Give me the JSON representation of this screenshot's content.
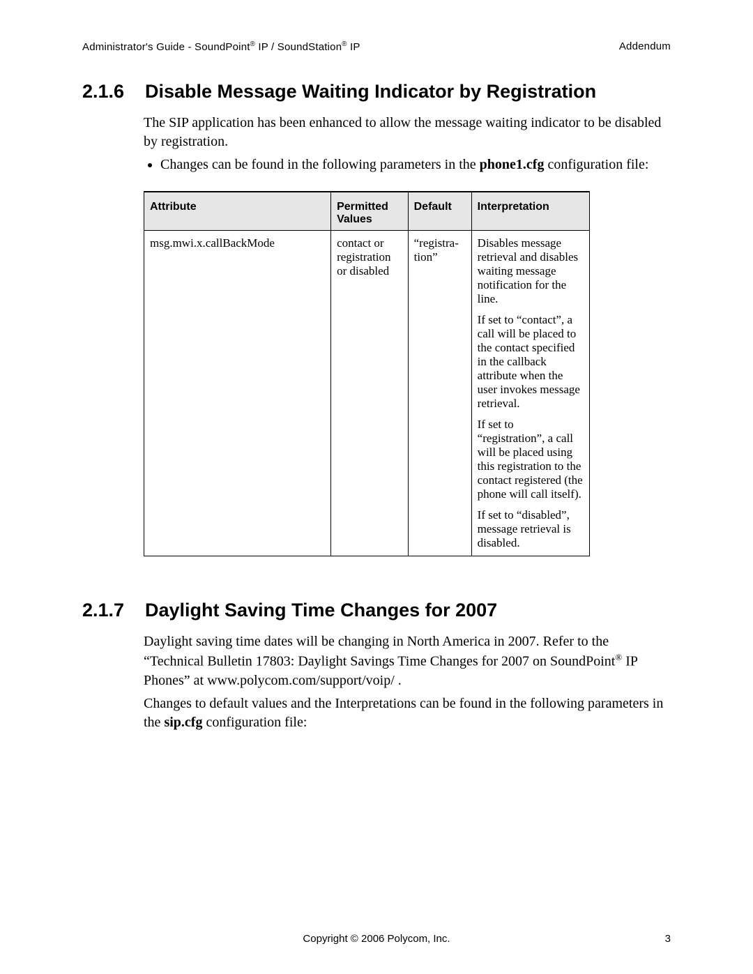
{
  "header": {
    "left_pre": "Administrator's Guide - SoundPoint",
    "left_mid": " IP / SoundStation",
    "left_post": " IP",
    "right": "Addendum",
    "reg": "®"
  },
  "section216": {
    "number": "2.1.6",
    "title": "Disable Message Waiting Indicator by Registration",
    "para1": "The SIP application has been enhanced to allow the message waiting indicator to be disabled by registration.",
    "bullet_pre": "Changes can be found in the following parameters in the ",
    "bullet_bold": "phone1.cfg",
    "bullet_post": " configuration file:"
  },
  "tableHead": {
    "attribute": "Attribute",
    "permitted": "Permitted Values",
    "default": "Default",
    "interpretation": "Interpretation"
  },
  "tableRow": {
    "attribute": "msg.mwi.x.callBackMode",
    "permitted": "contact or registration or disabled",
    "default": "“registra­tion”",
    "interp1": "Disables message retrieval and disables waiting message notifi­cation for the line.",
    "interp2": "If set to “contact”, a call will be placed to the contact specified in the callback attribute when the user invokes mes­sage retrieval.",
    "interp3": "If set to “registration”, a call will be placed using this registration to the contact registered (the phone will call itself).",
    "interp4": "If set to “disabled”, message retrieval is dis­abled."
  },
  "section217": {
    "number": "2.1.7",
    "title": "Daylight Saving Time Changes for 2007",
    "para1_pre": "Daylight saving time dates will be changing in North America in 2007. Refer to the “Technical Bulletin 17803: Daylight Savings Time Changes for 2007 on SoundPoint",
    "para1_post": " IP Phones” at www.polycom.com/support/voip/ .",
    "para2_pre": "Changes to default values and the Interpretations can be found in the following param­eters in the ",
    "para2_bold": "sip.cfg",
    "para2_post": " configuration file:"
  },
  "footer": {
    "copyright": "Copyright © 2006 Polycom, Inc.",
    "page": "3"
  }
}
